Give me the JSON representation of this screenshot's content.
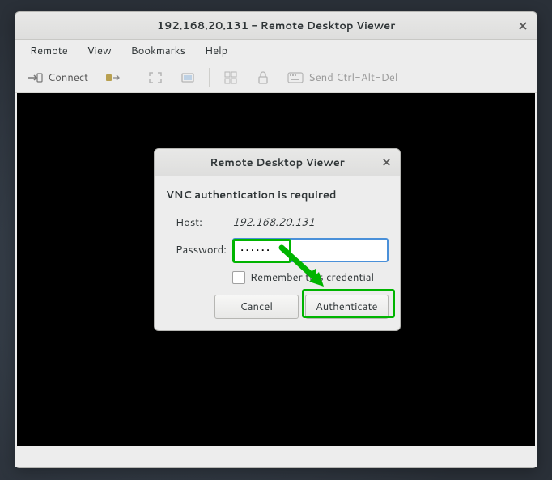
{
  "window": {
    "title": "192.168.20.131 - Remote Desktop Viewer"
  },
  "menubar": {
    "remote": "Remote",
    "view": "View",
    "bookmarks": "Bookmarks",
    "help": "Help"
  },
  "toolbar": {
    "connect": "Connect",
    "send_keys": "Send Ctrl-Alt-Del"
  },
  "dialog": {
    "title": "Remote Desktop Viewer",
    "heading": "VNC authentication is required",
    "host_label": "Host:",
    "host_value": "192.168.20.131",
    "password_label": "Password:",
    "password_value": "••••••",
    "remember_label": "Remember this credential",
    "cancel": "Cancel",
    "authenticate": "Authenticate"
  },
  "icons": {
    "close": "close-icon",
    "connect": "connect-icon",
    "disconnect": "disconnect-icon",
    "fullscreen": "fullscreen-icon",
    "fit": "fit-icon",
    "scale": "scale-icon",
    "readonly": "readonly-icon",
    "screenshot": "screenshot-icon"
  },
  "colors": {
    "highlight": "#00b400",
    "focus": "#4a90d9"
  }
}
